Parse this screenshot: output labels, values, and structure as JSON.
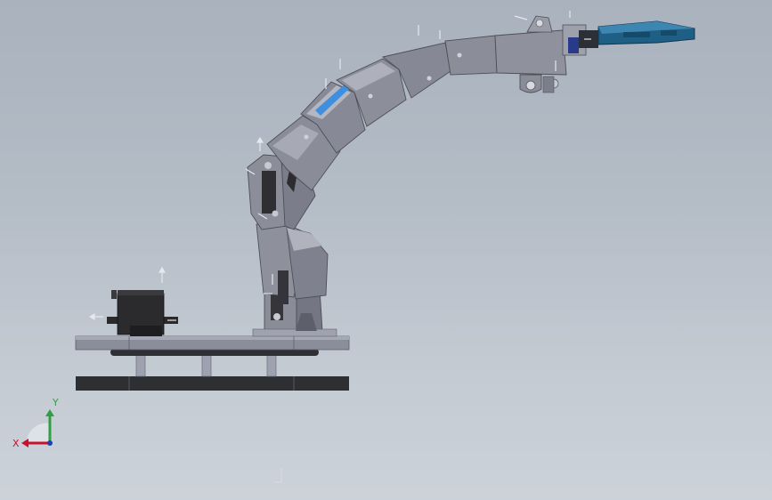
{
  "viewport": {
    "background_top": "#a9b2bd",
    "background_bottom": "#ccd2d9"
  },
  "model": {
    "parts": [
      "base-plate",
      "lower-plate",
      "standoff-posts",
      "servo-motor",
      "shoulder-bracket",
      "lower-arm-link",
      "elbow-bracket",
      "upper-arm-link",
      "wrist-link",
      "wrist-servo-bracket",
      "gripper"
    ],
    "colors": {
      "metal": "#8a8c98",
      "metal_light": "#a5a7b3",
      "metal_dark": "#5d5f6a",
      "servo": "#2a2a2c",
      "gripper": "#1f5f86",
      "highlight": "#3f8fe0",
      "plate_dark": "#2e2f33"
    }
  },
  "triad": {
    "x_label": "X",
    "y_label": "Y",
    "x_color": "#c8102e",
    "y_color": "#2ea043",
    "z_color": "#1f3fb5"
  }
}
